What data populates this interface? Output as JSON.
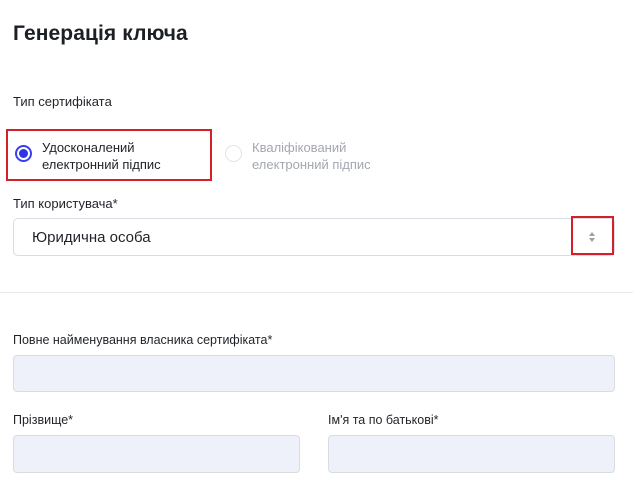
{
  "page": {
    "title": "Генерація ключа"
  },
  "certificate_type": {
    "label": "Тип сертифікатa",
    "options": [
      {
        "line1": "Удосконалений",
        "line2": "електронний підпис",
        "selected": true
      },
      {
        "line1": "Кваліфікований",
        "line2": "електронний підпис",
        "selected": false
      }
    ]
  },
  "user_type": {
    "label": "Тип користувача*",
    "value": "Юридична особа"
  },
  "fields": {
    "owner_full_name": {
      "label": "Повне найменування власника сертифіката*",
      "value": ""
    },
    "surname": {
      "label": "Прізвище*",
      "value": ""
    },
    "given_patronymic": {
      "label": "Ім'я та по батькові*",
      "value": ""
    }
  },
  "colors": {
    "accent": "#2f33e8",
    "highlight": "#d3202a",
    "input_bg": "#eef1fa",
    "border": "#d9dce2"
  }
}
